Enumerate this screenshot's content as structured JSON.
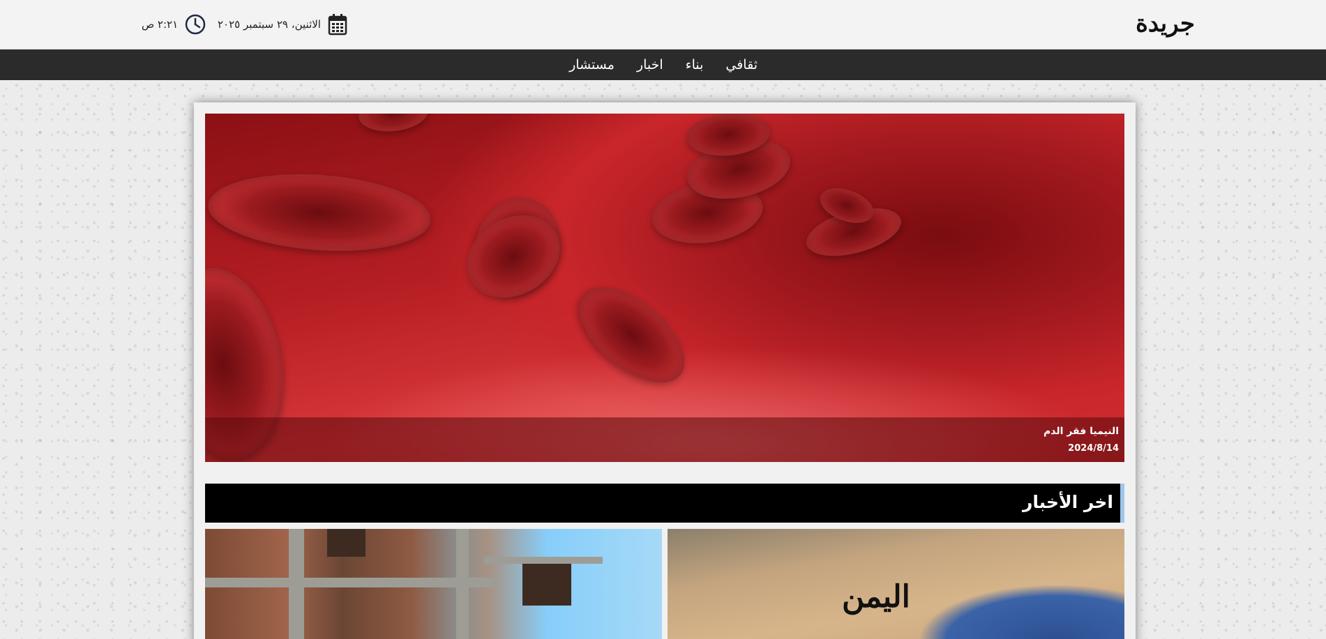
{
  "site": {
    "logo_text": "جريدة"
  },
  "header": {
    "date_text": "الاثنين، ٢٩ سبتمبر ٢٠٢٥",
    "time_text": "٢:٢١ ص"
  },
  "nav": {
    "items": [
      {
        "label": "ثقافي"
      },
      {
        "label": "بناء"
      },
      {
        "label": "اخبار"
      },
      {
        "label": "مستشار"
      }
    ]
  },
  "hero": {
    "title": "النيميا فقر الدم",
    "date": "2024/8/14"
  },
  "latest": {
    "title": "اخر الأخبار",
    "cards": [
      {
        "image_label": "اليمن"
      },
      {
        "image_label": ""
      }
    ]
  },
  "colors": {
    "nav_bg": "#2b2b2b",
    "section_header_bg": "#000000",
    "section_accent": "#9ec6ea"
  }
}
